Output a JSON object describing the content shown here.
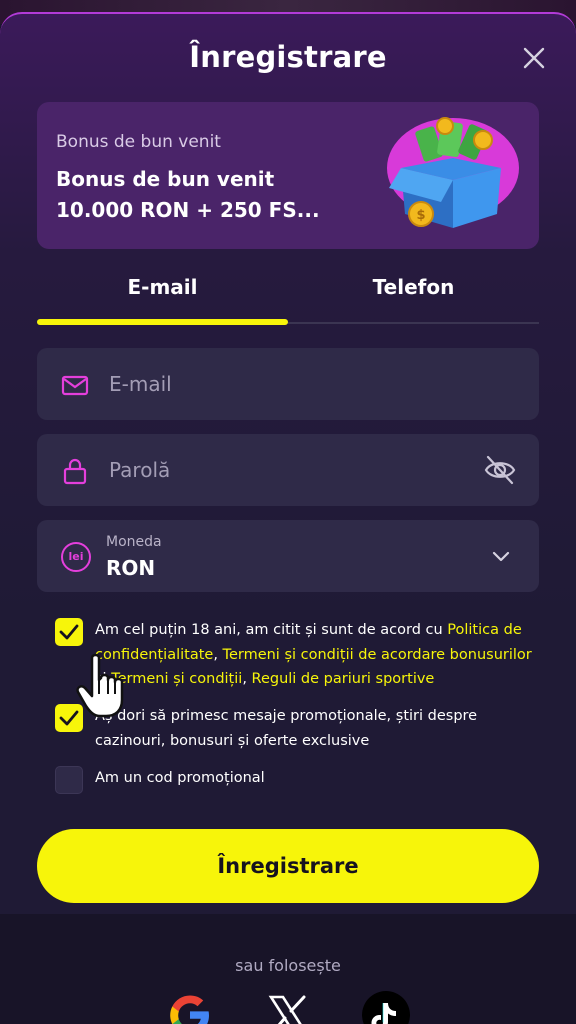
{
  "modal": {
    "title": "Înregistrare"
  },
  "bonus": {
    "subtitle": "Bonus de bun venit",
    "title": "Bonus de bun venit 10.000 RON + 250 FS..."
  },
  "tabs": [
    {
      "label": "E-mail",
      "active": true
    },
    {
      "label": "Telefon",
      "active": false
    }
  ],
  "form": {
    "email_placeholder": "E-mail",
    "password_placeholder": "Parolă",
    "currency": {
      "label": "Moneda",
      "value": "RON",
      "icon_text": "lei"
    }
  },
  "consents": {
    "terms": {
      "checked": true,
      "text_1": "Am cel puțin 18 ani, am citit și sunt de acord cu ",
      "link_privacy": "Politica de confidențialitate",
      "text_2": ", ",
      "link_bonus_terms": "Termeni și condiții de acordare bonusurilor",
      "text_3": " și ",
      "link_terms": "Termeni și condiții",
      "text_4": ", ",
      "link_betting_rules": "Reguli de pariuri sportive"
    },
    "marketing": {
      "checked": true,
      "text": "Aș dori să primesc mesaje promoționale, știri despre cazinouri, bonusuri și oferte exclusive"
    },
    "promo": {
      "checked": false,
      "text": "Am un cod promoțional"
    }
  },
  "submit_label": "Înregistrare",
  "footer": {
    "alt_text": "sau folosește",
    "social": [
      "google-icon",
      "x-icon",
      "tiktok-icon"
    ]
  },
  "colors": {
    "accent_yellow": "#f7f50a",
    "accent_magenta": "#e43fdc",
    "bonus_card_bg": "#4a2469",
    "field_bg": "#2f2a48"
  }
}
